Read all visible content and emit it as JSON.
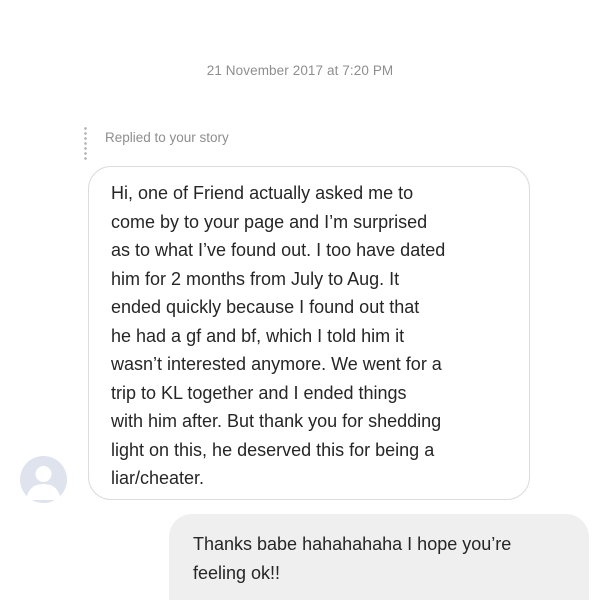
{
  "chat": {
    "timestamp": "21 November 2017 at 7:20 PM",
    "reply_indicator": "Replied to your story",
    "received_message_lines": [
      "Hi, one of Friend actually asked me to",
      "come by to your page and I’m surprised",
      "as to what I’ve found out. I too have dated",
      "him for 2 months from July to Aug. It",
      "ended quickly because I found out that",
      "he had a gf and bf, which I told him it",
      "wasn’t interested anymore. We went for a",
      "trip to KL together and I ended things",
      "with him after. But thank you for shedding",
      "light on this, he deserved this for being a",
      "liar/cheater."
    ],
    "sent_message_lines": [
      "Thanks babe hahahahaha I hope you’re",
      "feeling ok!!"
    ],
    "avatar_icon": "default-profile-icon"
  },
  "colors": {
    "meta_text": "#8e8e8e",
    "message_text": "#262626",
    "received_border": "#dcdcdc",
    "sent_background": "#efefef",
    "avatar_background": "#dfe3ee"
  }
}
